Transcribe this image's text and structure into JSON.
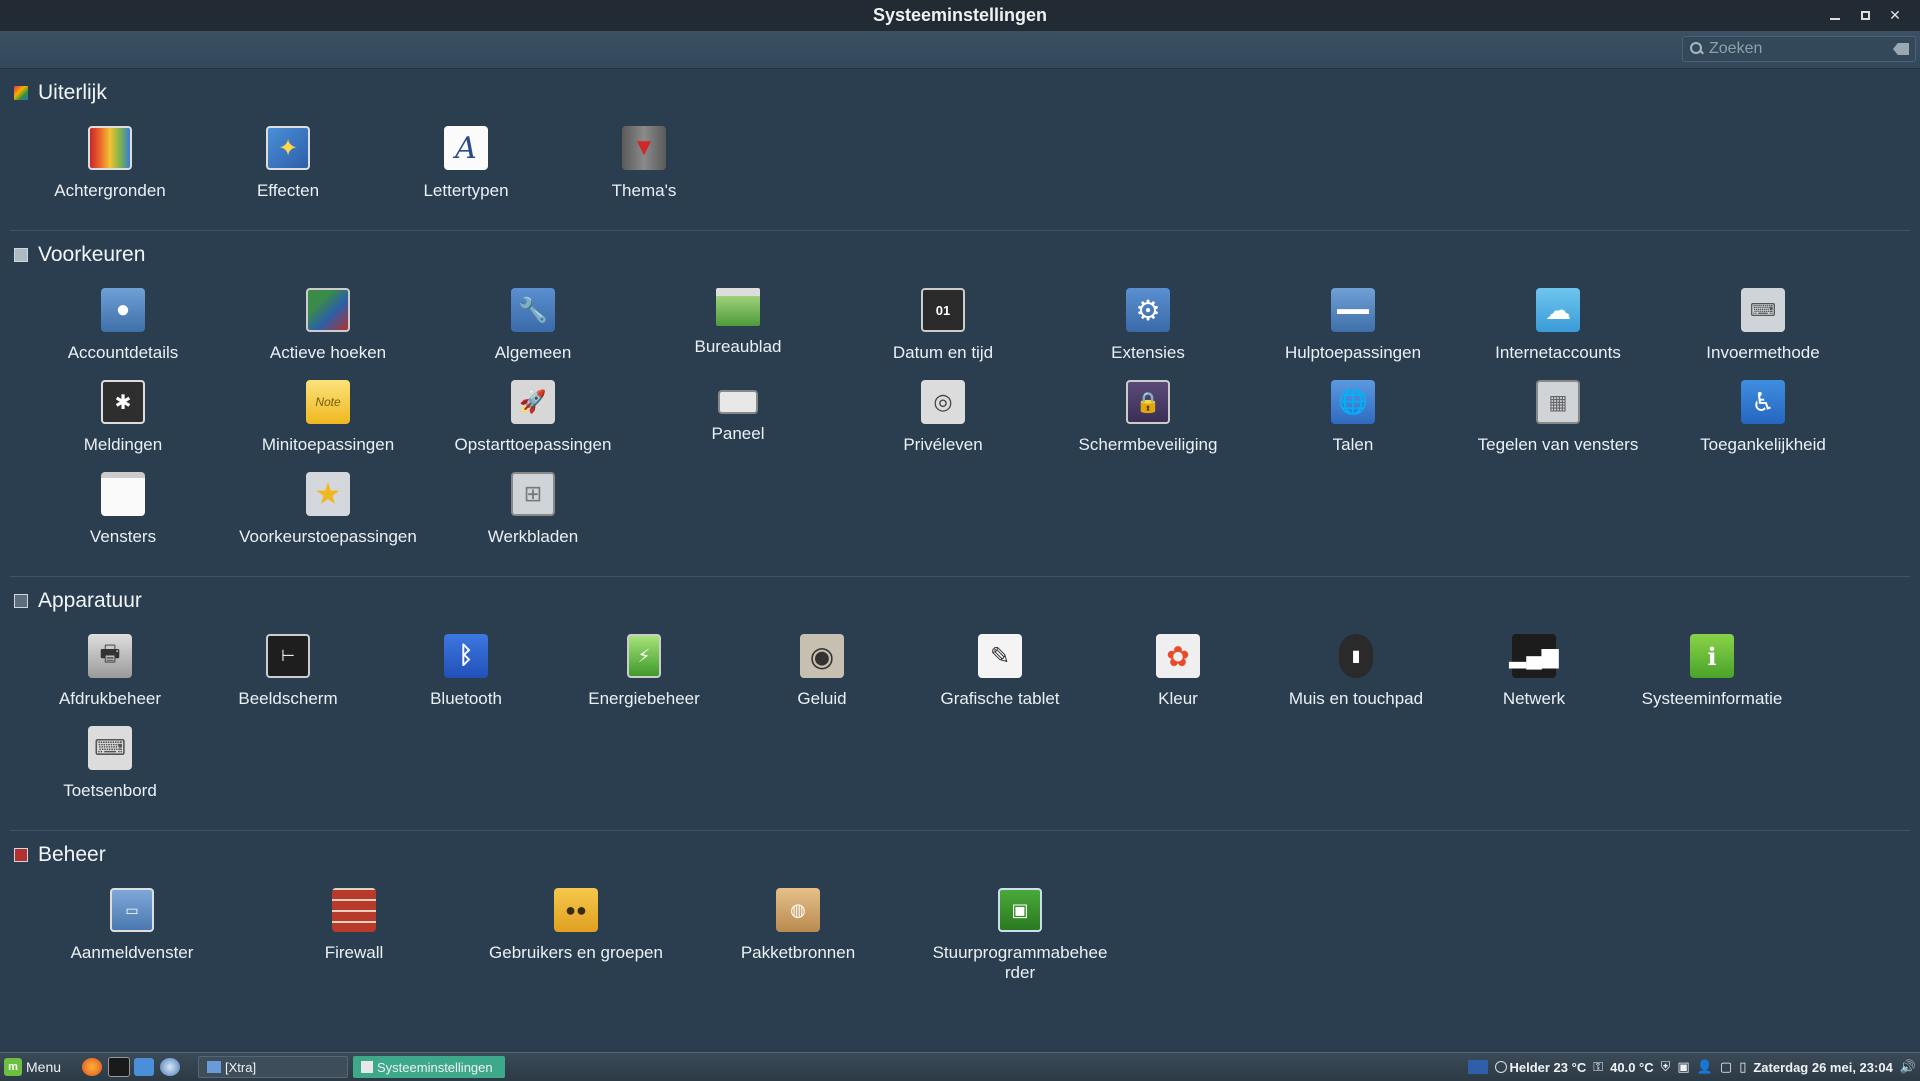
{
  "window": {
    "title": "Systeeminstellingen"
  },
  "search": {
    "placeholder": "Zoeken"
  },
  "sections": [
    {
      "title": "Uiterlijk",
      "items": [
        {
          "label": "Achtergronden",
          "icon": "backgrounds-icon"
        },
        {
          "label": "Effecten",
          "icon": "effects-icon"
        },
        {
          "label": "Lettertypen",
          "icon": "fonts-icon"
        },
        {
          "label": "Thema's",
          "icon": "themes-icon"
        }
      ]
    },
    {
      "title": "Voorkeuren",
      "items": [
        {
          "label": "Accountdetails",
          "icon": "account-icon"
        },
        {
          "label": "Actieve hoeken",
          "icon": "hot-corners-icon"
        },
        {
          "label": "Algemeen",
          "icon": "wrench-icon"
        },
        {
          "label": "Bureaublad",
          "icon": "desktop-icon"
        },
        {
          "label": "Datum en tijd",
          "icon": "calendar-icon"
        },
        {
          "label": "Extensies",
          "icon": "gear-icon"
        },
        {
          "label": "Hulptoepassingen",
          "icon": "applets-icon"
        },
        {
          "label": "Internetaccounts",
          "icon": "cloud-icon"
        },
        {
          "label": "Invoermethode",
          "icon": "input-method-icon"
        },
        {
          "label": "Meldingen",
          "icon": "notification-icon"
        },
        {
          "label": "Minitoepassingen",
          "icon": "desklets-icon"
        },
        {
          "label": "Opstarttoepassingen",
          "icon": "rocket-icon"
        },
        {
          "label": "Paneel",
          "icon": "panel-icon"
        },
        {
          "label": "Privéleven",
          "icon": "privacy-icon"
        },
        {
          "label": "Schermbeveiliging",
          "icon": "lock-icon"
        },
        {
          "label": "Talen",
          "icon": "globe-icon"
        },
        {
          "label": "Tegelen van vensters",
          "icon": "tiling-icon"
        },
        {
          "label": "Toegankelijkheid",
          "icon": "accessibility-icon"
        },
        {
          "label": "Vensters",
          "icon": "window-icon"
        },
        {
          "label": "Voorkeurstoepassingen",
          "icon": "star-icon"
        },
        {
          "label": "Werkbladen",
          "icon": "workspaces-icon"
        }
      ]
    },
    {
      "title": "Apparatuur",
      "items": [
        {
          "label": "Afdrukbeheer",
          "icon": "printer-icon"
        },
        {
          "label": "Beeldscherm",
          "icon": "display-icon"
        },
        {
          "label": "Bluetooth",
          "icon": "bluetooth-icon"
        },
        {
          "label": "Energiebeheer",
          "icon": "battery-icon"
        },
        {
          "label": "Geluid",
          "icon": "speaker-icon"
        },
        {
          "label": "Grafische tablet",
          "icon": "tablet-icon"
        },
        {
          "label": "Kleur",
          "icon": "color-icon"
        },
        {
          "label": "Muis en touchpad",
          "icon": "mouse-icon"
        },
        {
          "label": "Netwerk",
          "icon": "network-icon"
        },
        {
          "label": "Systeeminformatie",
          "icon": "info-icon"
        },
        {
          "label": "Toetsenbord",
          "icon": "keyboard-icon"
        }
      ]
    },
    {
      "title": "Beheer",
      "items": [
        {
          "label": "Aanmeldvenster",
          "icon": "login-window-icon"
        },
        {
          "label": "Firewall",
          "icon": "firewall-icon"
        },
        {
          "label": "Gebruikers en groepen",
          "icon": "users-icon"
        },
        {
          "label": "Pakketbronnen",
          "icon": "package-icon"
        },
        {
          "label": "Stuurprogrammabeheerder",
          "icon": "driver-icon"
        }
      ]
    }
  ],
  "taskbar": {
    "menu_label": "Menu",
    "tasks": [
      {
        "label": "[Xtra]"
      },
      {
        "label": "Systeeminstellingen"
      }
    ],
    "weather": "Helder 23 °C",
    "temperature": "40.0 °C",
    "clock": "Zaterdag 26 mei, 23:04"
  }
}
